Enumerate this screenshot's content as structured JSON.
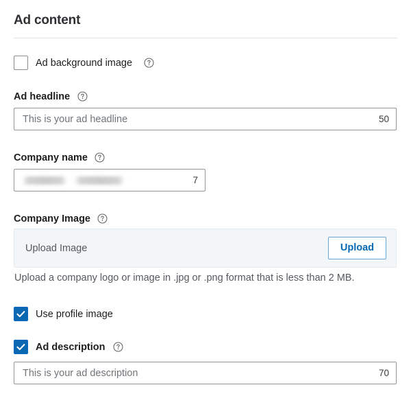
{
  "section": {
    "title": "Ad content"
  },
  "fields": {
    "ad_background_image": {
      "label": "Ad background image",
      "checked": false,
      "help_icon": "question-circle-icon"
    },
    "ad_headline": {
      "label": "Ad headline",
      "help_icon": "question-circle-icon",
      "placeholder": "This is your ad headline",
      "value": "",
      "counter": "50"
    },
    "company_name": {
      "label": "Company name",
      "help_icon": "question-circle-icon",
      "placeholder": "",
      "value": "",
      "value_redacted": true,
      "counter": "7"
    },
    "company_image": {
      "label": "Company Image",
      "help_icon": "question-circle-icon",
      "upload_text": "Upload Image",
      "upload_button": "Upload",
      "help_text": "Upload a company logo or image in .jpg or .png format that is less than 2 MB."
    },
    "use_profile_image": {
      "label": "Use profile image",
      "checked": true
    },
    "ad_description": {
      "label": "Ad description",
      "checked": true,
      "help_icon": "question-circle-icon",
      "placeholder": "This is your ad description",
      "value": "",
      "counter": "70"
    }
  },
  "colors": {
    "accent_blue": "#0a68b1",
    "link_blue": "#0a6ab4",
    "panel_bg": "#f2f6f8",
    "border_gray": "#949494",
    "divider": "#e3e3e5",
    "text_primary": "#1d1d1f",
    "text_secondary": "#55595e"
  }
}
